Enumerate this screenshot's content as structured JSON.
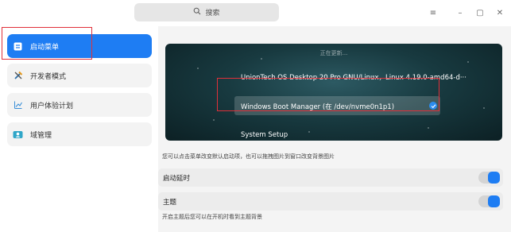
{
  "titlebar": {
    "search_label": "搜索",
    "window_buttons": [
      {
        "name": "menu-icon",
        "glyph": "≡"
      },
      {
        "name": "minimize-icon",
        "glyph": "–"
      },
      {
        "name": "maximize-icon",
        "glyph": "▢"
      },
      {
        "name": "close-icon",
        "glyph": "✕"
      }
    ]
  },
  "sidebar": {
    "items": [
      {
        "label": "启动菜单",
        "icon": "boot-menu-icon",
        "active": true
      },
      {
        "label": "开发者模式",
        "icon": "developer-tools-icon",
        "active": false
      },
      {
        "label": "用户体验计划",
        "icon": "user-experience-icon",
        "active": false
      },
      {
        "label": "域管理",
        "icon": "domain-management-icon",
        "active": false
      }
    ]
  },
  "boot_menu": {
    "status": "正在更新...",
    "entries": [
      {
        "label": "UnionTech OS Desktop 20 Pro GNU/Linux，Linux 4.19.0-amd64-d···",
        "selected": false
      },
      {
        "label": "Windows Boot Manager (在 /dev/nvme0n1p1)",
        "selected": true
      },
      {
        "label": "System Setup",
        "selected": false
      }
    ]
  },
  "hint_top": "您可以点击菜单改变默认启动项，也可以拖拽图片到窗口改变背景图片",
  "settings": [
    {
      "label": "启动延时",
      "enabled": true
    },
    {
      "label": "主题",
      "enabled": true
    }
  ],
  "hint_bottom": "开启主题后您可以在开机时看到主题背景",
  "colors": {
    "accent": "#1e7df3",
    "highlight_box": "#e0303a"
  }
}
